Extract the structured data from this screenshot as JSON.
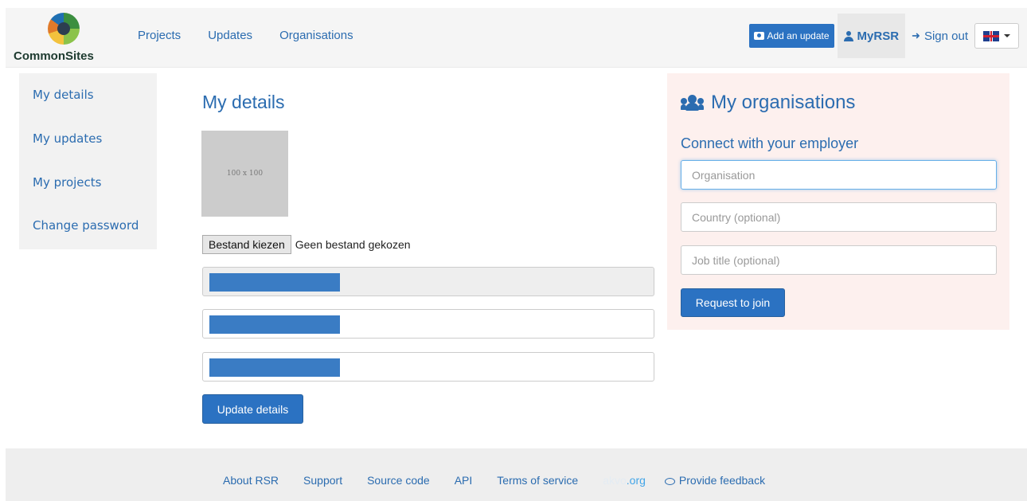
{
  "navbar": {
    "logo_text": "CommonSites",
    "links": [
      "Projects",
      "Updates",
      "Organisations"
    ],
    "add_update": "Add an update",
    "myrsr": "MyRSR",
    "sign_out": "Sign out",
    "lang_icon": "uk-flag-icon"
  },
  "sidebar": {
    "items": [
      "My details",
      "My updates",
      "My projects",
      "Change password"
    ]
  },
  "details": {
    "title": "My details",
    "avatar_placeholder": "100 x 100",
    "file_button": "Bestand kiezen",
    "file_status": "Geen bestand gekozen",
    "update_button": "Update details"
  },
  "organisations": {
    "title": "My organisations",
    "subtitle": "Connect with your employer",
    "org_placeholder": "Organisation",
    "country_placeholder": "Country (optional)",
    "job_placeholder": "Job title (optional)",
    "request_button": "Request to join"
  },
  "footer": {
    "links": [
      "About RSR",
      "Support",
      "Source code",
      "API",
      "Terms of service"
    ],
    "akvo_prefix": "akvo",
    "akvo_suffix": ".org",
    "feedback": "Provide feedback"
  },
  "colors": {
    "brand_blue": "#2b72c2",
    "link_blue": "#2b6cb0",
    "org_panel_bg": "#fdf0ee"
  }
}
